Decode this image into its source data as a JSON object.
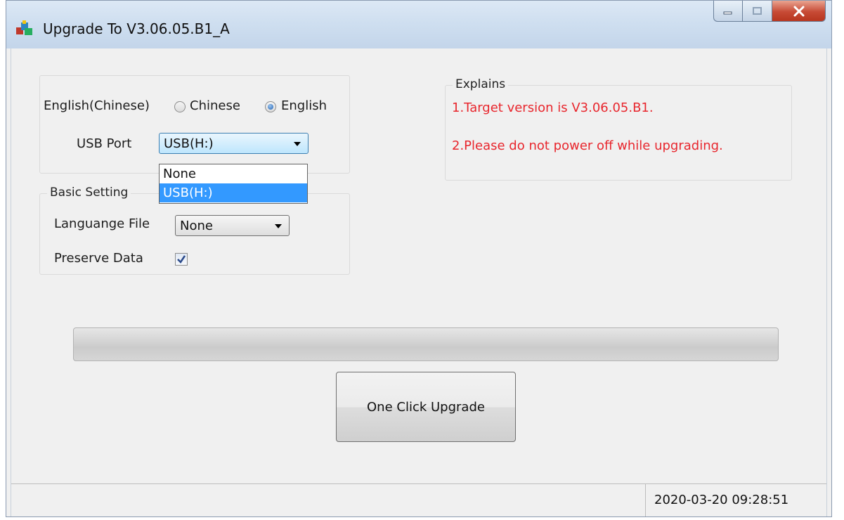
{
  "window": {
    "title": "Upgrade To V3.06.05.B1_A",
    "icon": "installer-icon"
  },
  "language": {
    "label": "English(Chinese)",
    "options": [
      {
        "label": "Chinese",
        "checked": false
      },
      {
        "label": "English",
        "checked": true
      }
    ]
  },
  "usb": {
    "label": "USB Port",
    "selected": "USB(H:)",
    "options": [
      "None",
      "USB(H:)"
    ],
    "highlighted": "USB(H:)"
  },
  "basic_setting": {
    "title": "Basic Setting",
    "language_file_label": "Languange File",
    "language_file_value": "None",
    "preserve_data_label": "Preserve Data",
    "preserve_data_checked": true
  },
  "explains": {
    "title": "Explains",
    "lines": [
      "1.Target version is V3.06.05.B1.",
      "2.Please do not power off while upgrading."
    ],
    "color": "#e8262d"
  },
  "progress": {
    "value": 0
  },
  "upgrade_button": {
    "label": "One Click Upgrade"
  },
  "status": {
    "timestamp": "2020-03-20 09:28:51"
  },
  "colors": {
    "selection": "#3399ff",
    "title_bar": "#cfdff0"
  }
}
